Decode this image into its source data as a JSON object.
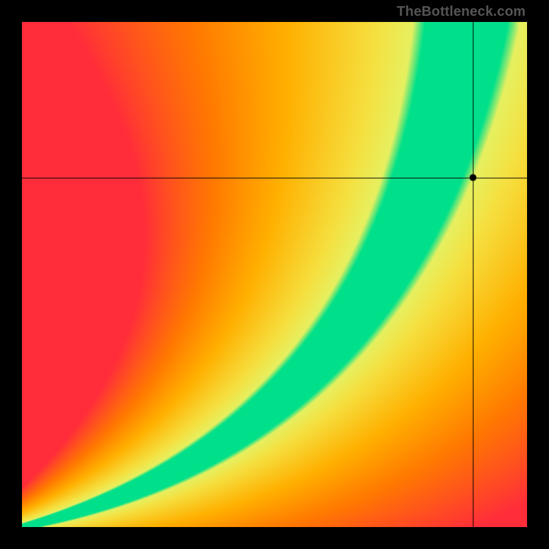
{
  "watermark": "TheBottleneck.com",
  "chart_data": {
    "type": "heatmap",
    "title": "",
    "xlabel": "",
    "ylabel": "",
    "xlim": [
      0,
      1
    ],
    "ylim": [
      0,
      1
    ],
    "crosshair": {
      "x": 0.893,
      "y": 0.692
    },
    "marker": {
      "x": 0.893,
      "y": 0.692,
      "color": "#000000",
      "radius": 5
    },
    "curve_control_points": {
      "description": "Quadratic Bezier control points (in normalized x,y with y up) defining the green optimal-match ridge from bottom-left to top-right. Width of green band (perpendicular distance) grows linearly with arc-length parameter t from ~0.005 at origin to ~0.08 at top.",
      "p0": [
        0.0,
        0.0
      ],
      "p1": [
        0.75,
        0.18
      ],
      "p2": [
        0.88,
        1.0
      ]
    },
    "color_stops": {
      "description": "Value is normalized perpendicular distance from ridge divided by local green half-width. Color ramps outward from ridge.",
      "stops": [
        {
          "v": 0.0,
          "color": "#00e08a"
        },
        {
          "v": 1.0,
          "color": "#00e08a"
        },
        {
          "v": 1.3,
          "color": "#e6f060"
        },
        {
          "v": 2.2,
          "color": "#f5e040"
        },
        {
          "v": 4.5,
          "color": "#ffb000"
        },
        {
          "v": 7.0,
          "color": "#ff7a00"
        },
        {
          "v": 11.0,
          "color": "#ff2d3a"
        }
      ]
    }
  }
}
